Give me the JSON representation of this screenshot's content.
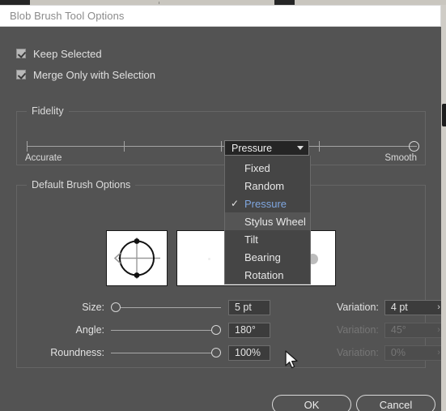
{
  "window": {
    "title": "Blob Brush Tool Options"
  },
  "options": {
    "keep_selected": {
      "label": "Keep Selected",
      "checked": true
    },
    "merge_only": {
      "label": "Merge Only with Selection",
      "checked": true
    }
  },
  "fidelity": {
    "group_title": "Fidelity",
    "left_label": "Accurate",
    "right_label": "Smooth",
    "ticks": 5,
    "value_position_percent": 100
  },
  "default_brush": {
    "group_title": "Default Brush Options",
    "size": {
      "label": "Size:",
      "value": "5 pt",
      "knob": "left",
      "variation_label": "Variation:",
      "variation_value": "4 pt",
      "variation_chevron": "›",
      "enabled": true
    },
    "angle": {
      "label": "Angle:",
      "value": "180°",
      "knob": "right",
      "variation_label": "Variation:",
      "variation_value": "45°",
      "variation_chevron": "›",
      "enabled": false
    },
    "roundness": {
      "label": "Roundness:",
      "value": "100%",
      "knob": "right",
      "variation_label": "Variation:",
      "variation_value": "0%",
      "variation_chevron": "›",
      "enabled": false
    }
  },
  "brush_type_select": {
    "selected": "Pressure",
    "expanded": true,
    "items": [
      {
        "label": "Fixed",
        "checked": false,
        "hovered": false
      },
      {
        "label": "Random",
        "checked": false,
        "hovered": false
      },
      {
        "label": "Pressure",
        "checked": true,
        "hovered": false
      },
      {
        "label": "Stylus Wheel",
        "checked": false,
        "hovered": true
      },
      {
        "label": "Tilt",
        "checked": false,
        "hovered": false
      },
      {
        "label": "Bearing",
        "checked": false,
        "hovered": false
      },
      {
        "label": "Rotation",
        "checked": false,
        "hovered": false
      }
    ],
    "check_glyph": "✓"
  },
  "buttons": {
    "ok": "OK",
    "cancel": "Cancel"
  },
  "colors": {
    "dialog_background": "#535353",
    "titlebar_background": "#ffffff",
    "titlebar_text": "#8b8b8b",
    "text": "#e2e2e2",
    "select_background": "#252525",
    "menu_background": "#454545",
    "menu_hover": "#555555",
    "selected_item_text": "#7fa6e0",
    "field_background": "#3c3c3c",
    "disabled_text": "#767676",
    "preview_background": "#ffffff"
  }
}
